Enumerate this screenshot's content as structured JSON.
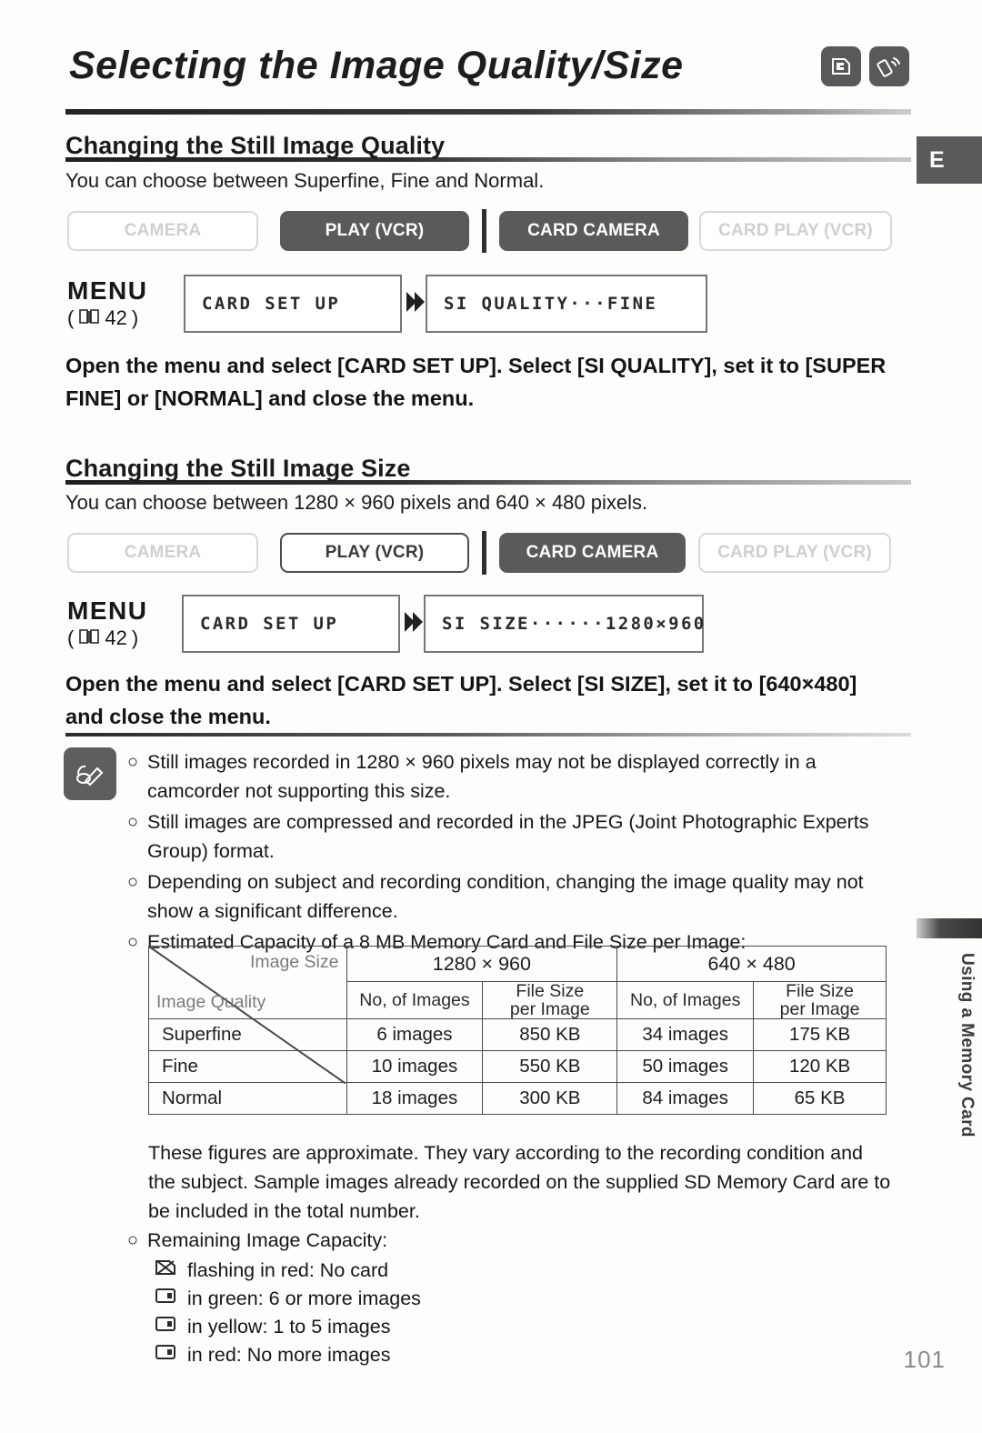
{
  "header": {
    "title": "Selecting the Image Quality/Size",
    "icons": [
      "memory-card-icon",
      "remote-control-icon"
    ]
  },
  "side_tab": {
    "label": "E"
  },
  "running_head": {
    "label": "Using a Memory Card"
  },
  "sections": [
    {
      "heading": "Changing the Still Image Quality",
      "lead": "You can choose between Superfine, Fine and Normal.",
      "modes": [
        {
          "label": "CAMERA",
          "state": "off"
        },
        {
          "label": "PLAY (VCR)",
          "state": "on"
        },
        {
          "label": "CARD CAMERA",
          "state": "on"
        },
        {
          "label": "CARD PLAY (VCR)",
          "state": "off"
        }
      ],
      "menu": {
        "label": "MENU",
        "reference": "42",
        "reference_prefix": "(",
        "reference_suffix": ")",
        "box1": "CARD SET UP",
        "box2": "SI QUALITY···FINE"
      },
      "instruction": "Open the menu and select [CARD SET UP]. Select [SI QUALITY], set it to [SUPER FINE] or [NORMAL] and close the menu."
    },
    {
      "heading": "Changing the Still Image Size",
      "lead": "You can choose between 1280 × 960 pixels and 640 × 480 pixels.",
      "modes": [
        {
          "label": "CAMERA",
          "state": "off"
        },
        {
          "label": "PLAY (VCR)",
          "state": "outline"
        },
        {
          "label": "CARD CAMERA",
          "state": "on"
        },
        {
          "label": "CARD PLAY (VCR)",
          "state": "off"
        }
      ],
      "menu": {
        "label": "MENU",
        "reference": "42",
        "reference_prefix": "(",
        "reference_suffix": ")",
        "box1": "CARD SET UP",
        "box2": "SI SIZE······1280×960"
      },
      "instruction": "Open the menu and select [CARD SET UP]. Select [SI SIZE], set it to [640×480] and close the menu."
    }
  ],
  "notes": {
    "bullet": "○",
    "items": [
      "Still images recorded in 1280 × 960 pixels may not be displayed correctly in a camcorder not supporting this size.",
      "Still images are compressed and recorded in the JPEG (Joint Photographic Experts Group) format.",
      "Depending on subject and recording condition, changing the image quality may not show a significant difference.",
      "Estimated Capacity of a 8 MB Memory Card and File Size per Image:"
    ],
    "after_table": "These figures are approximate. They vary according to the recording condition and the subject. Sample images already recorded on the supplied SD Memory Card are to be included in the total number.",
    "remaining_title": "Remaining Image Capacity:",
    "capacity_items": [
      {
        "icon": "no-card-icon",
        "text": "flashing in red: No card"
      },
      {
        "icon": "card-icon",
        "text": "in green: 6 or more images"
      },
      {
        "icon": "card-icon",
        "text": "in yellow: 1 to 5 images"
      },
      {
        "icon": "card-icon",
        "text": "in red: No more images"
      }
    ]
  },
  "table": {
    "corner_top_label": "Image Size",
    "corner_bottom_label": "Image Quality",
    "size_headers": [
      "1280 × 960",
      "640 × 480"
    ],
    "sub_headers": [
      "No. of Images",
      "File Size\nper Image",
      "No. of Images",
      "File Size\nper Image"
    ],
    "sub_headers_line1": [
      "No, of Images",
      "File Size",
      "No, of Images",
      "File Size"
    ],
    "sub_headers_line2": [
      "",
      "per Image",
      "",
      "per Image"
    ],
    "rows": [
      {
        "quality": "Superfine",
        "cells": [
          "6 images",
          "850 KB",
          "34 images",
          "175 KB"
        ]
      },
      {
        "quality": "Fine",
        "cells": [
          "10 images",
          "550 KB",
          "50 images",
          "120 KB"
        ]
      },
      {
        "quality": "Normal",
        "cells": [
          "18 images",
          "300 KB",
          "84 images",
          "65 KB"
        ]
      }
    ]
  },
  "footer": {
    "page_number": "101"
  },
  "stray_mark": "'"
}
